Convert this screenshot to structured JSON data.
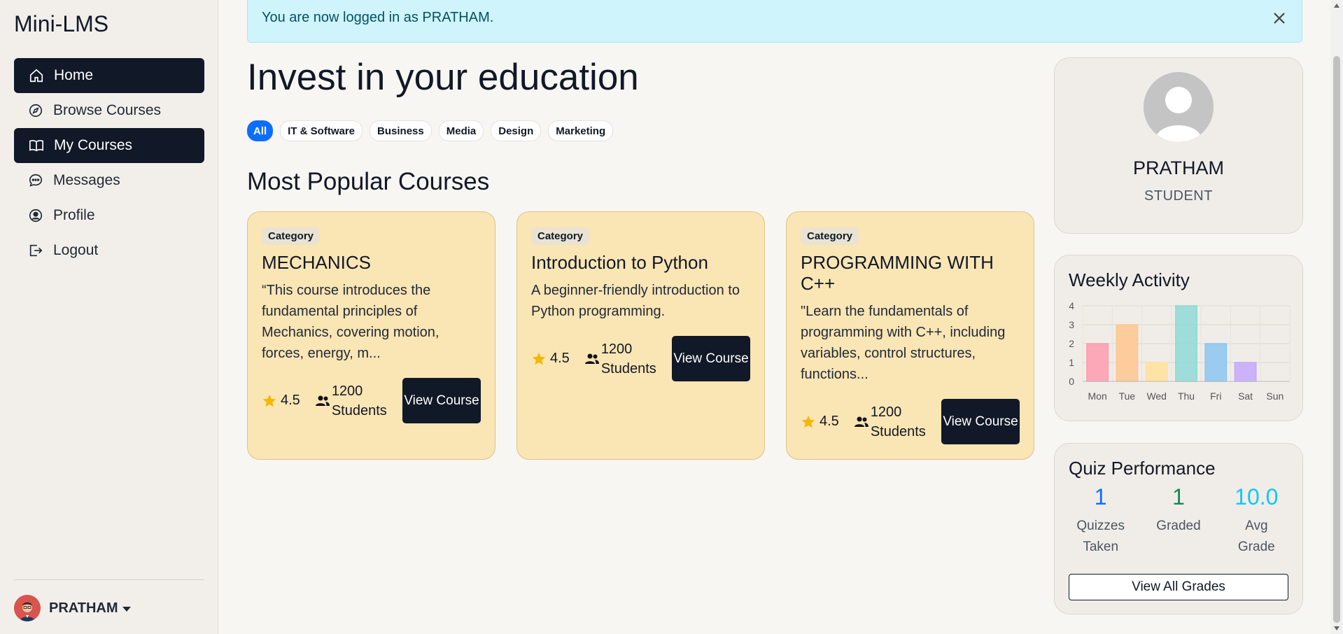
{
  "app": {
    "brand": "Mini-LMS"
  },
  "sidebar": {
    "items": [
      {
        "label": "Home",
        "icon": "home-icon",
        "active": true
      },
      {
        "label": "Browse Courses",
        "icon": "compass-icon",
        "active": false
      },
      {
        "label": "My Courses",
        "icon": "book-icon",
        "active": true
      },
      {
        "label": "Messages",
        "icon": "chat-icon",
        "active": false
      },
      {
        "label": "Profile",
        "icon": "user-circle-icon",
        "active": false
      },
      {
        "label": "Logout",
        "icon": "logout-icon",
        "active": false
      }
    ],
    "user": {
      "name": "PRATHAM"
    }
  },
  "alert": {
    "text": "You are now logged in as PRATHAM."
  },
  "main": {
    "headline": "Invest in your education",
    "chips": [
      "All",
      "IT & Software",
      "Business",
      "Media",
      "Design",
      "Marketing"
    ],
    "section_title": "Most Popular Courses",
    "courses": [
      {
        "badge": "Category",
        "title": "MECHANICS",
        "desc": "“This course introduces the fundamental principles of Mechanics, covering motion, forces, energy, m...",
        "rating": "4.5",
        "students": "1200 Students",
        "button": "View Course"
      },
      {
        "badge": "Category",
        "title": "Introduction to Python",
        "desc": "A beginner-friendly introduction to Python programming.",
        "rating": "4.5",
        "students": "1200 Students",
        "button": "View Course"
      },
      {
        "badge": "Category",
        "title": "PROGRAMMING WITH C++",
        "desc": "\"Learn the fundamentals of programming with C++, including variables, control structures, functions...",
        "rating": "4.5",
        "students": "1200 Students",
        "button": "View Course"
      }
    ]
  },
  "profile": {
    "name": "PRATHAM",
    "role": "STUDENT"
  },
  "activity": {
    "title": "Weekly Activity"
  },
  "chart_data": {
    "type": "bar",
    "title": "Weekly Activity",
    "categories": [
      "Mon",
      "Tue",
      "Wed",
      "Thu",
      "Fri",
      "Sat",
      "Sun"
    ],
    "values": [
      2,
      3,
      1,
      4,
      2,
      1,
      0
    ],
    "ylim": [
      0,
      4
    ],
    "yticks": [
      "0",
      "1",
      "2",
      "3",
      "4"
    ],
    "grid": true,
    "colors": [
      "#ff9bb0",
      "#ffc68f",
      "#ffe19a",
      "#8fd9d6",
      "#8cc6f0",
      "#c6a7fa",
      "#cccccc"
    ]
  },
  "quiz": {
    "title": "Quiz Performance",
    "stats": [
      {
        "value": "1",
        "label_line1": "Quizzes",
        "label_line2": "Taken",
        "color": "#0d6efd"
      },
      {
        "value": "1",
        "label_line1": "Graded",
        "label_line2": "",
        "color": "#198754"
      },
      {
        "value": "10.0",
        "label_line1": "Avg",
        "label_line2": "Grade",
        "color": "#0dcaf0"
      }
    ],
    "button": "View All Grades"
  }
}
